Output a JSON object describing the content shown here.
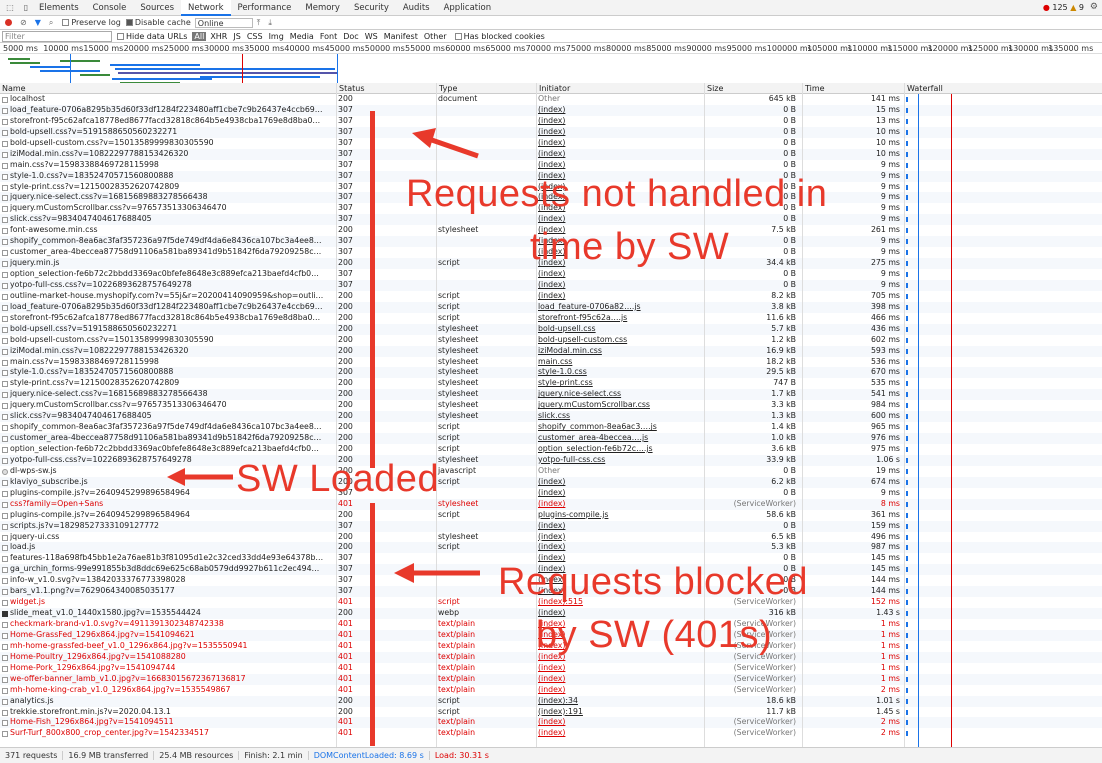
{
  "tabs": [
    "Elements",
    "Console",
    "Sources",
    "Network",
    "Performance",
    "Memory",
    "Security",
    "Audits",
    "Application"
  ],
  "active_tab": "Network",
  "errors": {
    "error_count": "125",
    "warning_count": "9"
  },
  "toolbar": {
    "preserve_log": "Preserve log",
    "disable_cache": "Disable cache",
    "throttle": "Online"
  },
  "filter": {
    "placeholder": "Filter",
    "hide_data": "Hide data URLs",
    "types": [
      "All",
      "XHR",
      "JS",
      "CSS",
      "Img",
      "Media",
      "Font",
      "Doc",
      "WS",
      "Manifest",
      "Other"
    ],
    "blocked": "Has blocked cookies"
  },
  "timeline_ticks": [
    "5000 ms",
    "10000 ms",
    "15000 ms",
    "20000 ms",
    "25000 ms",
    "30000 ms",
    "35000 ms",
    "40000 ms",
    "45000 ms",
    "50000 ms",
    "55000 ms",
    "60000 ms",
    "65000 ms",
    "70000 ms",
    "75000 ms",
    "80000 ms",
    "85000 ms",
    "90000 ms",
    "95000 ms",
    "100000 ms",
    "105000 ms",
    "110000 ms",
    "115000 ms",
    "120000 ms",
    "125000 ms",
    "130000 ms",
    "135000 ms"
  ],
  "columns": {
    "name": "Name",
    "status": "Status",
    "type": "Type",
    "initiator": "Initiator",
    "size": "Size",
    "time": "Time",
    "waterfall": "Waterfall"
  },
  "rows": [
    {
      "name": "localhost",
      "status": "200",
      "type": "document",
      "initiator": "Other",
      "size": "645 kB",
      "time": "141 ms"
    },
    {
      "name": "load_feature-0706a8295b35d60f33df1284f223480aff1cbe7c9b26437e4ccb69…",
      "status": "307",
      "type": "",
      "initiator": "(index)",
      "size": "0 B",
      "time": "15 ms"
    },
    {
      "name": "storefront-f95c62afca18778ed8677facd32818c864b5e4938cba1769e8d8ba0…",
      "status": "307",
      "type": "",
      "initiator": "(index)",
      "size": "0 B",
      "time": "13 ms"
    },
    {
      "name": "bold-upsell.css?v=5191588650560232271",
      "status": "307",
      "type": "",
      "initiator": "(index)",
      "size": "0 B",
      "time": "10 ms"
    },
    {
      "name": "bold-upsell-custom.css?v=15013589999830305590",
      "status": "307",
      "type": "",
      "initiator": "(index)",
      "size": "0 B",
      "time": "10 ms"
    },
    {
      "name": "iziModal.min.css?v=10822297788153426320",
      "status": "307",
      "type": "",
      "initiator": "(index)",
      "size": "0 B",
      "time": "10 ms"
    },
    {
      "name": "main.css?v=15983388469728115998",
      "status": "307",
      "type": "",
      "initiator": "(index)",
      "size": "0 B",
      "time": "9 ms"
    },
    {
      "name": "style-1.0.css?v=18352470571560800888",
      "status": "307",
      "type": "",
      "initiator": "(index)",
      "size": "0 B",
      "time": "9 ms"
    },
    {
      "name": "style-print.css?v=12150028352620742809",
      "status": "307",
      "type": "",
      "initiator": "(index)",
      "size": "0 B",
      "time": "9 ms"
    },
    {
      "name": "jquery.nice-select.css?v=16815689883278566438",
      "status": "307",
      "type": "",
      "initiator": "(index)",
      "size": "0 B",
      "time": "9 ms"
    },
    {
      "name": "jquery.mCustomScrollbar.css?v=976573513306346470",
      "status": "307",
      "type": "",
      "initiator": "(index)",
      "size": "0 B",
      "time": "9 ms"
    },
    {
      "name": "slick.css?v=9834047404617688405",
      "status": "307",
      "type": "",
      "initiator": "(index)",
      "size": "0 B",
      "time": "9 ms"
    },
    {
      "name": "font-awesome.min.css",
      "status": "200",
      "type": "stylesheet",
      "initiator": "(index)",
      "size": "7.5 kB",
      "time": "261 ms"
    },
    {
      "name": "shopify_common-8ea6ac3faf357236a97f5de749df4da6e8436ca107bc3a4ee8…",
      "status": "307",
      "type": "",
      "initiator": "(index)",
      "size": "0 B",
      "time": "9 ms"
    },
    {
      "name": "customer_area-4beccea87758d91106a581ba89341d9b51842f6da79209258c…",
      "status": "307",
      "type": "",
      "initiator": "(index)",
      "size": "0 B",
      "time": "9 ms"
    },
    {
      "name": "jquery.min.js",
      "status": "200",
      "type": "script",
      "initiator": "(index)",
      "size": "34.4 kB",
      "time": "275 ms"
    },
    {
      "name": "option_selection-fe6b72c2bbdd3369ac0bfefe8648e3c889efca213baefd4cfb0…",
      "status": "307",
      "type": "",
      "initiator": "(index)",
      "size": "0 B",
      "time": "9 ms"
    },
    {
      "name": "yotpo-full-css.css?v=10226893628757649278",
      "status": "307",
      "type": "",
      "initiator": "(index)",
      "size": "0 B",
      "time": "9 ms"
    },
    {
      "name": "outline-market-house.myshopify.com?v=55j&r=20200414090959&shop=outli…",
      "status": "200",
      "type": "script",
      "initiator": "(index)",
      "size": "8.2 kB",
      "time": "705 ms"
    },
    {
      "name": "load_feature-0706a8295b35d60f33df1284f223480aff1cbe7c9b26437e4ccb69…",
      "status": "200",
      "type": "script",
      "initiator": "load_feature-0706a82….js",
      "size": "3.8 kB",
      "time": "398 ms"
    },
    {
      "name": "storefront-f95c62afca18778ed8677facd32818c864b5e4938cba1769e8d8ba0…",
      "status": "200",
      "type": "script",
      "initiator": "storefront-f95c62a….js",
      "size": "11.6 kB",
      "time": "466 ms"
    },
    {
      "name": "bold-upsell.css?v=5191588650560232271",
      "status": "200",
      "type": "stylesheet",
      "initiator": "bold-upsell.css",
      "size": "5.7 kB",
      "time": "436 ms"
    },
    {
      "name": "bold-upsell-custom.css?v=15013589999830305590",
      "status": "200",
      "type": "stylesheet",
      "initiator": "bold-upsell-custom.css",
      "size": "1.2 kB",
      "time": "602 ms"
    },
    {
      "name": "iziModal.min.css?v=10822297788153426320",
      "status": "200",
      "type": "stylesheet",
      "initiator": "iziModal.min.css",
      "size": "16.9 kB",
      "time": "593 ms"
    },
    {
      "name": "main.css?v=15983388469728115998",
      "status": "200",
      "type": "stylesheet",
      "initiator": "main.css",
      "size": "18.2 kB",
      "time": "536 ms"
    },
    {
      "name": "style-1.0.css?v=18352470571560800888",
      "status": "200",
      "type": "stylesheet",
      "initiator": "style-1.0.css",
      "size": "29.5 kB",
      "time": "670 ms"
    },
    {
      "name": "style-print.css?v=12150028352620742809",
      "status": "200",
      "type": "stylesheet",
      "initiator": "style-print.css",
      "size": "747 B",
      "time": "535 ms"
    },
    {
      "name": "jquery.nice-select.css?v=16815689883278566438",
      "status": "200",
      "type": "stylesheet",
      "initiator": "jquery.nice-select.css",
      "size": "1.7 kB",
      "time": "541 ms"
    },
    {
      "name": "jquery.mCustomScrollbar.css?v=976573513306346470",
      "status": "200",
      "type": "stylesheet",
      "initiator": "jquery.mCustomScrollbar.css",
      "size": "3.3 kB",
      "time": "984 ms"
    },
    {
      "name": "slick.css?v=9834047404617688405",
      "status": "200",
      "type": "stylesheet",
      "initiator": "slick.css",
      "size": "1.3 kB",
      "time": "600 ms"
    },
    {
      "name": "shopify_common-8ea6ac3faf357236a97f5de749df4da6e8436ca107bc3a4ee8…",
      "status": "200",
      "type": "script",
      "initiator": "shopify_common-8ea6ac3….js",
      "size": "1.4 kB",
      "time": "965 ms"
    },
    {
      "name": "customer_area-4beccea87758d91106a581ba89341d9b51842f6da79209258c…",
      "status": "200",
      "type": "script",
      "initiator": "customer_area-4beccea….js",
      "size": "1.0 kB",
      "time": "976 ms"
    },
    {
      "name": "option_selection-fe6b72c2bbdd3369ac0bfefe8648e3c889efca213baefd4cfb0…",
      "status": "200",
      "type": "script",
      "initiator": "option_selection-fe6b72c….js",
      "size": "3.6 kB",
      "time": "975 ms"
    },
    {
      "name": "yotpo-full-css.css?v=10226893628757649278",
      "status": "200",
      "type": "stylesheet",
      "initiator": "yotpo-full-css.css",
      "size": "33.9 kB",
      "time": "1.06 s"
    },
    {
      "name": "dl-wps-sw.js",
      "status": "200",
      "type": "javascript",
      "initiator": "Other",
      "size": "0 B",
      "time": "19 ms",
      "icon": "gear"
    },
    {
      "name": "klaviyo_subscribe.js",
      "status": "200",
      "type": "script",
      "initiator": "(index)",
      "size": "6.2 kB",
      "time": "674 ms"
    },
    {
      "name": "plugins-compile.js?v=2640945299896584964",
      "status": "307",
      "type": "",
      "initiator": "(index)",
      "size": "0 B",
      "time": "9 ms"
    },
    {
      "name": "css?family=Open+Sans",
      "status": "401",
      "type": "stylesheet",
      "initiator": "(index)",
      "size": "(ServiceWorker)",
      "time": "8 ms",
      "err": true
    },
    {
      "name": "plugins-compile.js?v=2640945299896584964",
      "status": "200",
      "type": "script",
      "initiator": "plugins-compile.js",
      "size": "58.6 kB",
      "time": "361 ms"
    },
    {
      "name": "scripts.js?v=18298527333109127772",
      "status": "307",
      "type": "",
      "initiator": "(index)",
      "size": "0 B",
      "time": "159 ms"
    },
    {
      "name": "jquery-ui.css",
      "status": "200",
      "type": "stylesheet",
      "initiator": "(index)",
      "size": "6.5 kB",
      "time": "496 ms"
    },
    {
      "name": "load.js",
      "status": "200",
      "type": "script",
      "initiator": "(index)",
      "size": "5.3 kB",
      "time": "987 ms"
    },
    {
      "name": "features-118a698fb45bb1e2a76ae81b3f81095d1e2c32ced33dd4e93e64378b…",
      "status": "307",
      "type": "",
      "initiator": "(index)",
      "size": "0 B",
      "time": "145 ms"
    },
    {
      "name": "ga_urchin_forms-99e991855b3d8ddc69e625c68ab0579dd9927b611c2ec494…",
      "status": "307",
      "type": "",
      "initiator": "(index)",
      "size": "0 B",
      "time": "145 ms"
    },
    {
      "name": "info-w_v1.0.svg?v=13842033376773398028",
      "status": "307",
      "type": "",
      "initiator": "(index)",
      "size": "0 B",
      "time": "144 ms"
    },
    {
      "name": "bars_v1.1.png?v=7629064340085035177",
      "status": "307",
      "type": "",
      "initiator": "(index)",
      "size": "0 B",
      "time": "144 ms"
    },
    {
      "name": "widget.js",
      "status": "401",
      "type": "script",
      "initiator": "(index):515",
      "size": "(ServiceWorker)",
      "time": "152 ms",
      "err": true
    },
    {
      "name": "slide_meat_v1.0_1440x1580.jpg?v=1535544424",
      "status": "200",
      "type": "webp",
      "initiator": "(index)",
      "size": "316 kB",
      "time": "1.43 s",
      "icon": "img"
    },
    {
      "name": "checkmark-brand-v1.0.svg?v=4911391302348742338",
      "status": "401",
      "type": "text/plain",
      "initiator": "(index)",
      "size": "(ServiceWorker)",
      "time": "1 ms",
      "err": true
    },
    {
      "name": "Home-GrassFed_1296x864.jpg?v=1541094621",
      "status": "401",
      "type": "text/plain",
      "initiator": "(index)",
      "size": "(ServiceWorker)",
      "time": "1 ms",
      "err": true
    },
    {
      "name": "mh-home-grassfed-beef_v1.0_1296x864.jpg?v=1535550941",
      "status": "401",
      "type": "text/plain",
      "initiator": "(index)",
      "size": "(ServiceWorker)",
      "time": "1 ms",
      "err": true
    },
    {
      "name": "Home-Poultry_1296x864.jpg?v=1541088280",
      "status": "401",
      "type": "text/plain",
      "initiator": "(index)",
      "size": "(ServiceWorker)",
      "time": "1 ms",
      "err": true
    },
    {
      "name": "Home-Pork_1296x864.jpg?v=1541094744",
      "status": "401",
      "type": "text/plain",
      "initiator": "(index)",
      "size": "(ServiceWorker)",
      "time": "1 ms",
      "err": true
    },
    {
      "name": "we-offer-banner_lamb_v1.0.jpg?v=16683015672367136817",
      "status": "401",
      "type": "text/plain",
      "initiator": "(index)",
      "size": "(ServiceWorker)",
      "time": "1 ms",
      "err": true
    },
    {
      "name": "mh-home-king-crab_v1.0_1296x864.jpg?v=1535549867",
      "status": "401",
      "type": "text/plain",
      "initiator": "(index)",
      "size": "(ServiceWorker)",
      "time": "2 ms",
      "err": true
    },
    {
      "name": "analytics.js",
      "status": "200",
      "type": "script",
      "initiator": "(index):34",
      "size": "18.6 kB",
      "time": "1.01 s"
    },
    {
      "name": "trekkie.storefront.min.js?v=2020.04.13.1",
      "status": "200",
      "type": "script",
      "initiator": "(index):191",
      "size": "11.7 kB",
      "time": "1.45 s"
    },
    {
      "name": "Home-Fish_1296x864.jpg?v=1541094511",
      "status": "401",
      "type": "text/plain",
      "initiator": "(index)",
      "size": "(ServiceWorker)",
      "time": "2 ms",
      "err": true
    },
    {
      "name": "Surf-Turf_800x800_crop_center.jpg?v=1542334517",
      "status": "401",
      "type": "text/plain",
      "initiator": "(index)",
      "size": "(ServiceWorker)",
      "time": "2 ms",
      "err": true
    }
  ],
  "statusbar": {
    "requests": "371 requests",
    "transferred": "16.9 MB transferred",
    "resources": "25.4 MB resources",
    "finish": "Finish: 2.1 min",
    "dcl": "DOMContentLoaded: 8.69 s",
    "load": "Load: 30.31 s"
  },
  "annotations": {
    "not_handled_line1": "Requests not handled in",
    "not_handled_line2": "time by SW",
    "sw_loaded": "SW Loaded",
    "blocked_line1": "Requests blocked",
    "blocked_line2": "by SW (401s)"
  },
  "colors": {
    "annotation": "#e8392b",
    "error": "#d00000",
    "accent": "#1a73e8"
  }
}
